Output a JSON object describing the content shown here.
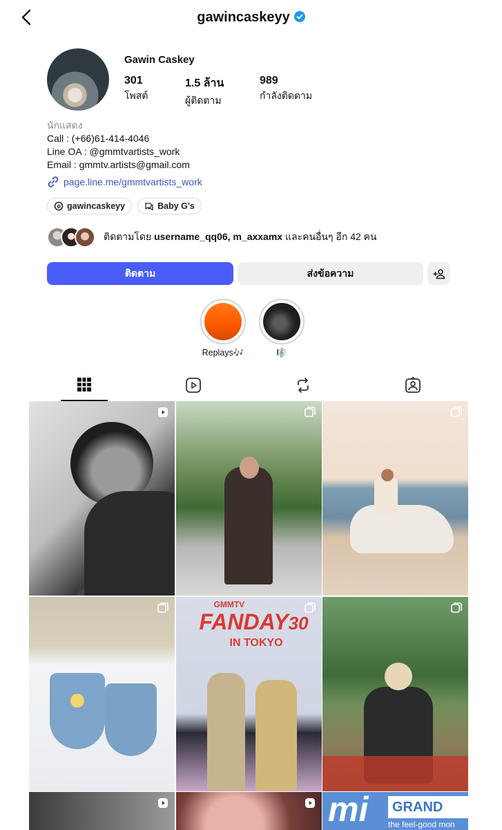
{
  "header": {
    "username": "gawincaskeyy"
  },
  "profile": {
    "name": "Gawin Caskey",
    "stats": [
      {
        "value": "301",
        "label": "โพสต์"
      },
      {
        "value": "1.5 ล้าน",
        "label": "ผู้ติดตาม"
      },
      {
        "value": "989",
        "label": "กำลังติดตาม"
      }
    ],
    "category": "นักแสดง",
    "bio_lines": [
      "Call : (+66)61-414-4046",
      "Line OA : @gmmtvartists_work",
      "Email : gmmtv.artists@gmail.com"
    ],
    "link": "page.line.me/gmmtvartists_work",
    "chips": [
      {
        "label": "gawincaskeyy",
        "icon": "threads-icon"
      },
      {
        "label": "Baby G's",
        "icon": "channel-icon"
      }
    ],
    "followed_by": {
      "prefix": "ติดตามโดย ",
      "names": "username_qq06, m_axxamx",
      "suffix": " และคนอื่นๆ อีก 42 คน"
    }
  },
  "actions": {
    "follow": "ติดตาม",
    "message": "ส่งข้อความ"
  },
  "highlights": [
    {
      "label": "Replays🎶"
    },
    {
      "label": "🎼"
    }
  ],
  "tabs": [
    "grid-icon",
    "reels-icon",
    "reposts-icon",
    "tagged-icon"
  ],
  "colors": {
    "accent": "#4a5df9",
    "verified": "#1d9bf0",
    "link": "#3a55c4"
  },
  "grid_posts": [
    {
      "badge": "reel",
      "desc": "bw portrait"
    },
    {
      "badge": "carousel",
      "desc": "leather jacket park"
    },
    {
      "badge": "carousel",
      "desc": "horse on beach"
    },
    {
      "badge": "carousel",
      "desc": "knitted bags"
    },
    {
      "badge": "carousel",
      "desc": "fanday stage"
    },
    {
      "badge": "carousel",
      "desc": "boat river"
    },
    {
      "badge": "reel",
      "desc": "row3 a"
    },
    {
      "badge": "reel",
      "desc": "row3 b"
    },
    {
      "badge": "carousel",
      "desc": "row3 c"
    }
  ],
  "grid_texts": {
    "fanday": "FANDAY",
    "fanday_num": "30",
    "tokyo": "IN TOKYO",
    "gmmtv": "GMMTV",
    "grand_brand": "GRAND",
    "grand_tag": "the feel-good mon"
  }
}
